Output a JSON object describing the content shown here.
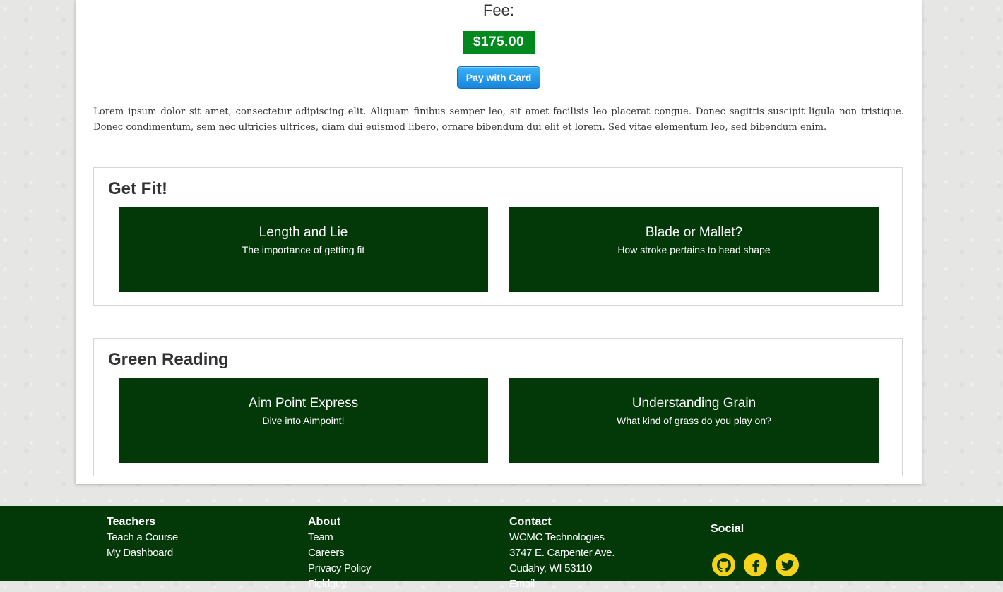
{
  "fee": {
    "label": "Fee:",
    "amount": "$175.00",
    "pay_button": "Pay with Card"
  },
  "description": "Lorem ipsum dolor sit amet, consectetur adipiscing elit. Aliquam finibus semper leo, sit amet facilisis leo placerat congue. Donec sagittis suscipit ligula non tristique. Donec condimentum, sem nec ultricies ultrices, diam dui euismod libero, ornare bibendum dui elit et lorem. Sed vitae elementum leo, sed bibendum enim.",
  "sections": [
    {
      "title": "Get Fit!",
      "cards": [
        {
          "title": "Length and Lie",
          "subtitle": "The importance of getting fit"
        },
        {
          "title": "Blade or Mallet?",
          "subtitle": "How stroke pertains to head shape"
        }
      ]
    },
    {
      "title": "Green Reading",
      "cards": [
        {
          "title": "Aim Point Express",
          "subtitle": "Dive into Aimpoint!"
        },
        {
          "title": "Understanding Grain",
          "subtitle": "What kind of grass do you play on?"
        }
      ]
    }
  ],
  "footer": {
    "teachers": {
      "heading": "Teachers",
      "links": [
        "Teach a Course",
        "My Dashboard"
      ]
    },
    "about": {
      "heading": "About",
      "links": [
        "Team",
        "Careers",
        "Privacy Policy",
        "Fieldguy"
      ]
    },
    "contact": {
      "heading": "Contact",
      "lines": [
        "WCMC Technologies",
        "3747 E. Carpenter Ave.",
        "Cudahy, WI 53110",
        "Email"
      ]
    },
    "social": {
      "heading": "Social",
      "icons": [
        "github-icon",
        "facebook-icon",
        "twitter-icon"
      ]
    }
  },
  "colors": {
    "brand_green": "#033808",
    "fee_green": "#008a1e",
    "social_yellow": "#f5d31a",
    "pay_blue": "#1885dc"
  }
}
